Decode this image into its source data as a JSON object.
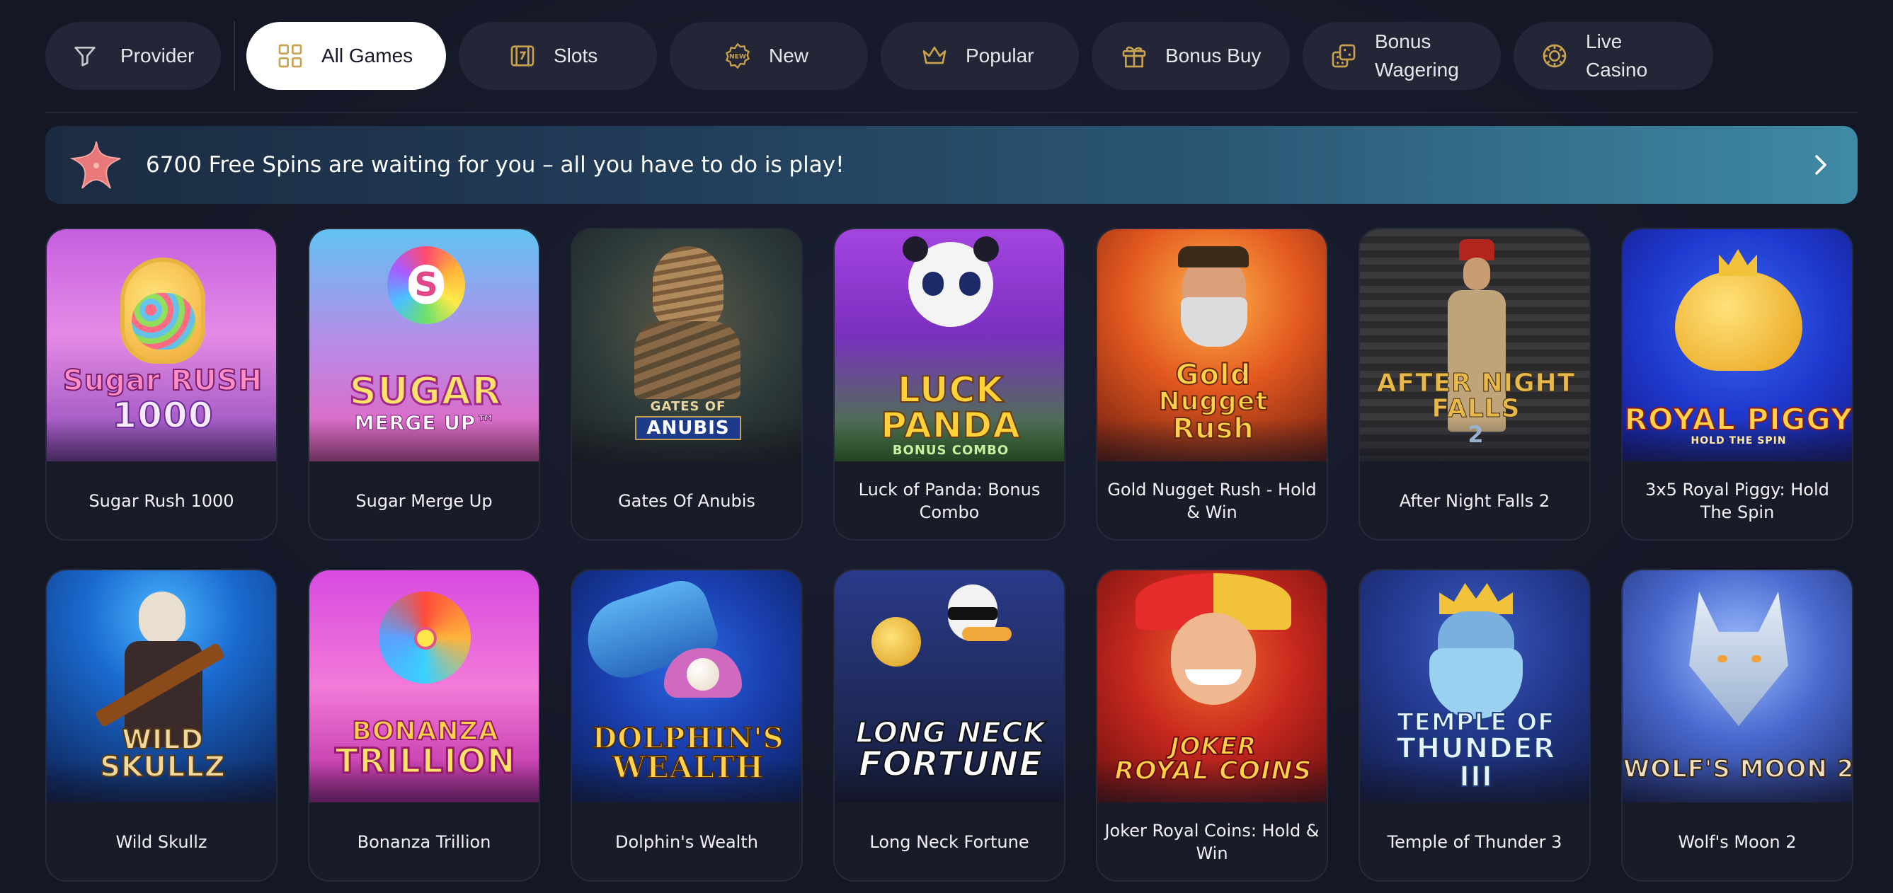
{
  "filters": {
    "provider": {
      "label": "Provider",
      "icon": "filter-icon"
    },
    "items": [
      {
        "label": "All Games",
        "icon": "grid-icon",
        "active": true
      },
      {
        "label": "Slots",
        "icon": "slot-seven-icon"
      },
      {
        "label": "New",
        "icon": "new-badge-icon"
      },
      {
        "label": "Popular",
        "icon": "crown-icon"
      },
      {
        "label": "Bonus Buy",
        "icon": "gift-icon"
      },
      {
        "label": "Bonus\nWagering",
        "icon": "dice-icon"
      },
      {
        "label": "Live\nCasino",
        "icon": "casino-chip-icon"
      }
    ],
    "accent": "#c9a24f"
  },
  "promo": {
    "text": "6700 Free Spins are waiting for you – all you have to do is play!",
    "icon": "starfish-icon"
  },
  "games": [
    {
      "name": "Sugar Rush 1000",
      "logo": [
        "Sugar RUSH",
        "1000"
      ],
      "bg": [
        "#d86bd6",
        "#8a3fb8"
      ]
    },
    {
      "name": "Sugar Merge Up",
      "logo": [
        "SUGAR",
        "MERGE UP™"
      ],
      "bg": [
        "#6fc3f0",
        "#e45ab8"
      ]
    },
    {
      "name": "Gates Of Anubis",
      "logo": [
        "GATES OF",
        "ANUBIS"
      ],
      "bg": [
        "#2c4a4e",
        "#5a3222"
      ]
    },
    {
      "name": "Luck of Panda: Bonus Combo",
      "logo": [
        "LUCK",
        "PANDA",
        "BONUS COMBO"
      ],
      "bg": [
        "#9b3fd3",
        "#3e9b2f"
      ]
    },
    {
      "name": "Gold Nugget Rush - Hold & Win",
      "logo": [
        "Gold",
        "Nugget",
        "Rush"
      ],
      "bg": [
        "#f06b24",
        "#7a1f10"
      ]
    },
    {
      "name": "After Night Falls 2",
      "logo": [
        "AFTER NIGHT FALLS",
        "2"
      ],
      "bg": [
        "#3b3a3a",
        "#1e1d1f"
      ]
    },
    {
      "name": "3x5 Royal Piggy: Hold The Spin",
      "logo": [
        "ROYAL PIGGY",
        "HOLD THE SPIN"
      ],
      "bg": [
        "#2a4bd6",
        "#1a1f8a"
      ]
    },
    {
      "name": "Wild Skullz",
      "logo": [
        "WILD",
        "SKULLZ"
      ],
      "bg": [
        "#1a8fe0",
        "#0c1e50"
      ]
    },
    {
      "name": "Bonanza Trillion",
      "logo": [
        "BONANZA",
        "TRILLION"
      ],
      "bg": [
        "#e85ad8",
        "#b02aa0"
      ]
    },
    {
      "name": "Dolphin's Wealth",
      "logo": [
        "DOLPHIN'S",
        "WEALTH"
      ],
      "bg": [
        "#1a4fbf",
        "#0a1f5a"
      ]
    },
    {
      "name": "Long Neck Fortune",
      "logo": [
        "LONG NECK",
        "FORTUNE"
      ],
      "bg": [
        "#2b3a7a",
        "#151b3a"
      ]
    },
    {
      "name": "Joker Royal Coins: Hold & Win",
      "logo": [
        "JOKER",
        "ROYAL COINS"
      ],
      "bg": [
        "#d8352a",
        "#6a0f0f"
      ]
    },
    {
      "name": "Temple of Thunder 3",
      "logo": [
        "TEMPLE OF",
        "THUNDER",
        "III"
      ],
      "bg": [
        "#2a4a9a",
        "#16244e"
      ]
    },
    {
      "name": "Wolf's Moon 2",
      "logo": [
        "WOLF'S MOON 2"
      ],
      "bg": [
        "#6b8fe0",
        "#1c2a6a"
      ]
    }
  ]
}
